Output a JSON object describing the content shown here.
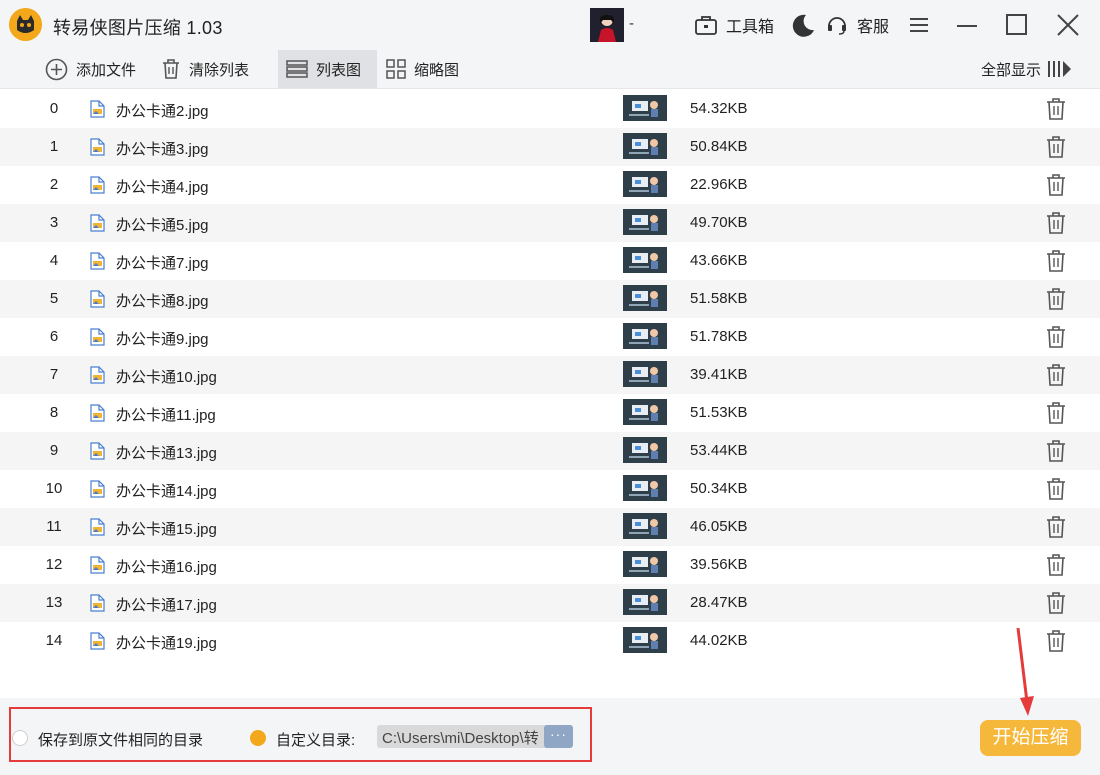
{
  "app": {
    "title": "转易侠图片压缩 1.03",
    "user_name": "-"
  },
  "header": {
    "toolbox_label": "工具箱",
    "support_label": "客服"
  },
  "toolbar": {
    "add_file": "添加文件",
    "clear_list": "清除列表",
    "list_view": "列表图",
    "thumb_view": "缩略图",
    "show_all": "全部显示"
  },
  "files": [
    {
      "index": "0",
      "name": "办公卡通2.jpg",
      "size": "54.32KB"
    },
    {
      "index": "1",
      "name": "办公卡通3.jpg",
      "size": "50.84KB"
    },
    {
      "index": "2",
      "name": "办公卡通4.jpg",
      "size": "22.96KB"
    },
    {
      "index": "3",
      "name": "办公卡通5.jpg",
      "size": "49.70KB"
    },
    {
      "index": "4",
      "name": "办公卡通7.jpg",
      "size": "43.66KB"
    },
    {
      "index": "5",
      "name": "办公卡通8.jpg",
      "size": "51.58KB"
    },
    {
      "index": "6",
      "name": "办公卡通9.jpg",
      "size": "51.78KB"
    },
    {
      "index": "7",
      "name": "办公卡通10.jpg",
      "size": "39.41KB"
    },
    {
      "index": "8",
      "name": "办公卡通11.jpg",
      "size": "51.53KB"
    },
    {
      "index": "9",
      "name": "办公卡通13.jpg",
      "size": "53.44KB"
    },
    {
      "index": "10",
      "name": "办公卡通14.jpg",
      "size": "50.34KB"
    },
    {
      "index": "11",
      "name": "办公卡通15.jpg",
      "size": "46.05KB"
    },
    {
      "index": "12",
      "name": "办公卡通16.jpg",
      "size": "39.56KB"
    },
    {
      "index": "13",
      "name": "办公卡通17.jpg",
      "size": "28.47KB"
    },
    {
      "index": "14",
      "name": "办公卡通19.jpg",
      "size": "44.02KB"
    }
  ],
  "footer": {
    "save_same_dir": "保存到原文件相同的目录",
    "custom_dir": "自定义目录:",
    "custom_path": "C:\\Users\\mi\\Desktop\\转",
    "browse": "···",
    "start": "开始压缩"
  },
  "colors": {
    "accent": "#f6b83a",
    "highlight_box": "#e53b3b",
    "radio_on": "#f3a81c"
  }
}
